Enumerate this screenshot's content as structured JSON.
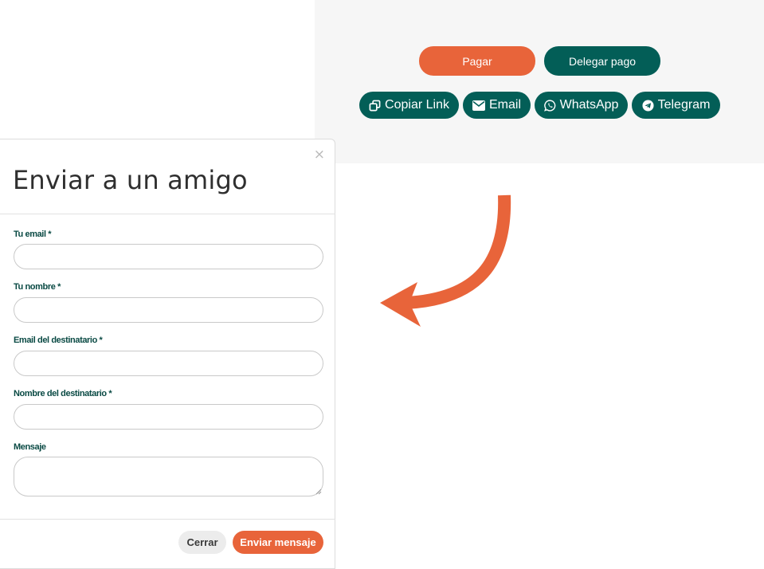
{
  "payment": {
    "pay_label": "Pagar",
    "delegate_label": "Delegar pago",
    "share": {
      "copy_link_label": "Copiar Link",
      "email_label": "Email",
      "whatsapp_label": "WhatsApp",
      "telegram_label": "Telegram"
    }
  },
  "modal": {
    "close_glyph": "×",
    "title": "Enviar a un amigo",
    "fields": [
      {
        "label": "Tu email *",
        "value": ""
      },
      {
        "label": "Tu nombre *",
        "value": ""
      },
      {
        "label": "Email del destinatario *",
        "value": ""
      },
      {
        "label": "Nombre del destinatario *",
        "value": ""
      },
      {
        "label": "Mensaje",
        "value": ""
      }
    ],
    "close_label": "Cerrar",
    "send_label": "Enviar mensaje"
  },
  "icons": {
    "copy": "copy-icon",
    "email": "envelope-icon",
    "whatsapp": "whatsapp-icon",
    "telegram": "telegram-icon",
    "arrow": "curved-arrow-icon"
  },
  "colors": {
    "accent_orange": "#e8643a",
    "brand_teal": "#035e57",
    "panel_bg": "#f6f6f6",
    "label_teal": "#0a4a44"
  }
}
